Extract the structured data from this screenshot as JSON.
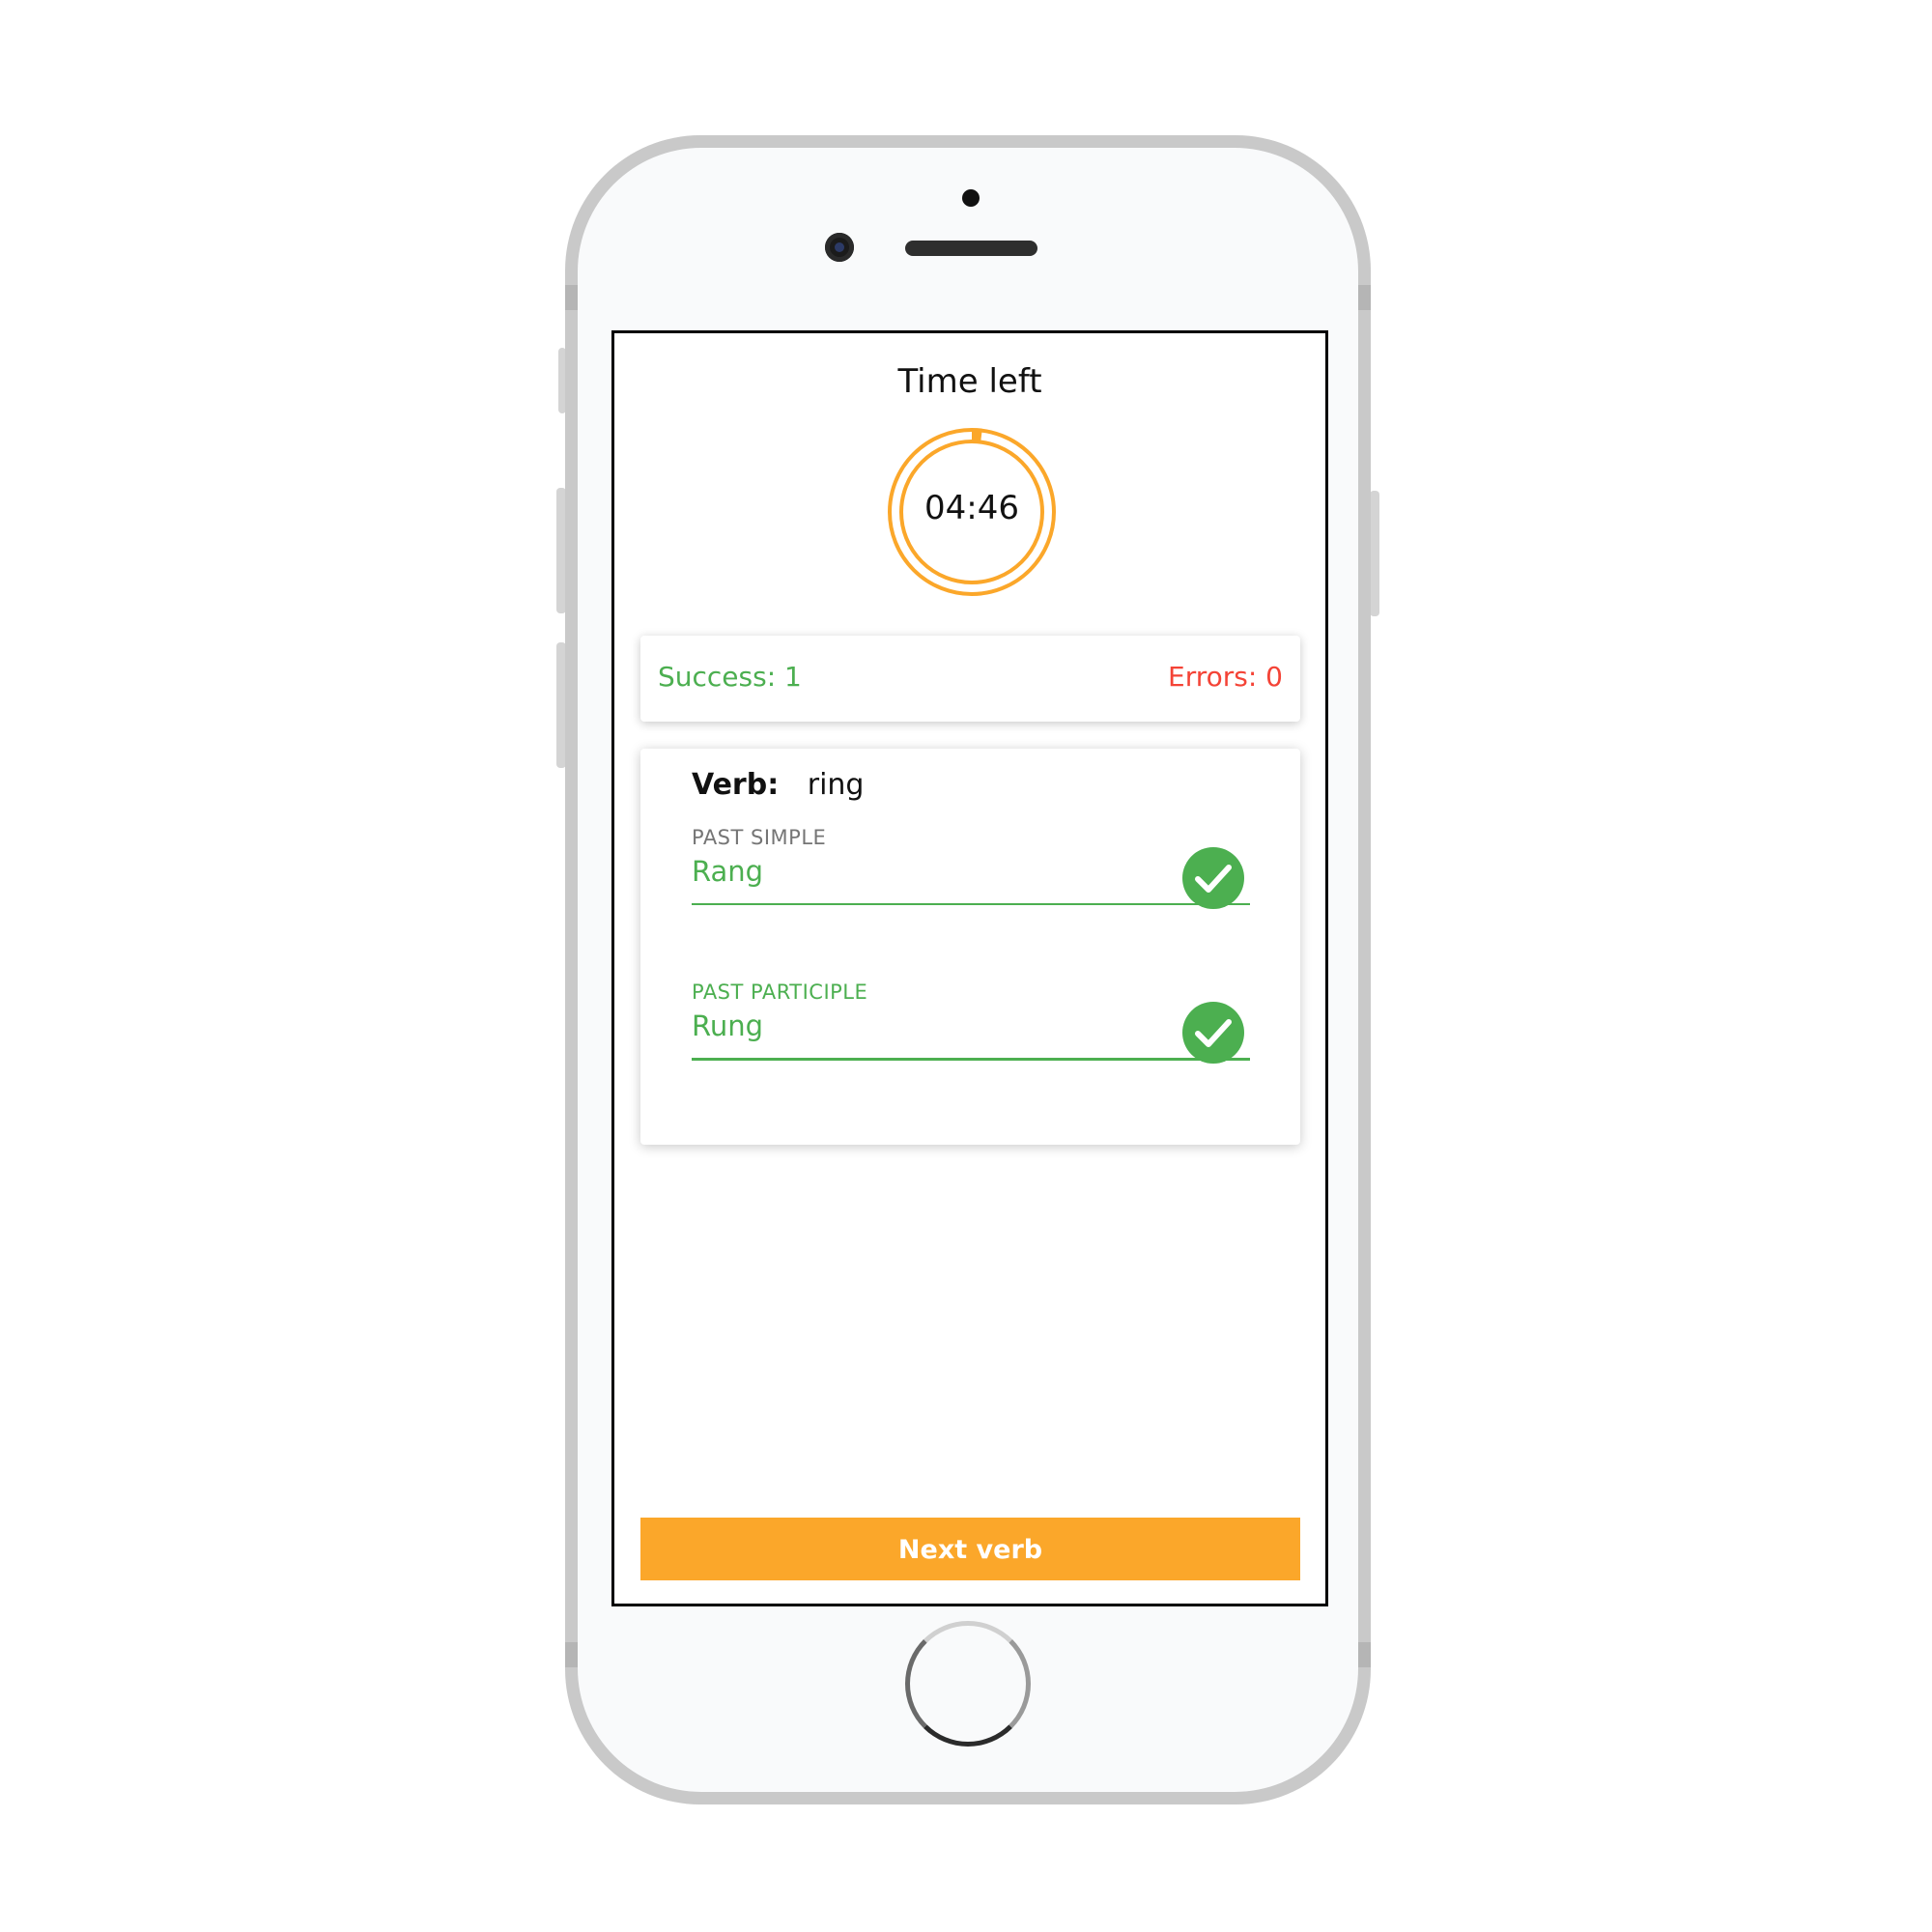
{
  "timer": {
    "title": "Time left",
    "value": "04:46",
    "remaining_fraction": 0.99,
    "ring_color": "#fba72a"
  },
  "score": {
    "success_text": "Success: 1",
    "errors_text": "Errors: 0",
    "success_color": "#4caf50",
    "errors_color": "#f44336"
  },
  "verb": {
    "label": "Verb:",
    "value": "ring"
  },
  "fields": [
    {
      "label": "PAST SIMPLE",
      "value": "Rang",
      "status": "correct",
      "status_icon": "check-circle-icon",
      "label_color": "#757575"
    },
    {
      "label": "PAST PARTICIPLE",
      "value": "Rung",
      "status": "correct",
      "status_icon": "check-circle-icon",
      "label_color": "#4caf50"
    }
  ],
  "next_button": {
    "label": "Next verb",
    "color": "#fba72a"
  }
}
